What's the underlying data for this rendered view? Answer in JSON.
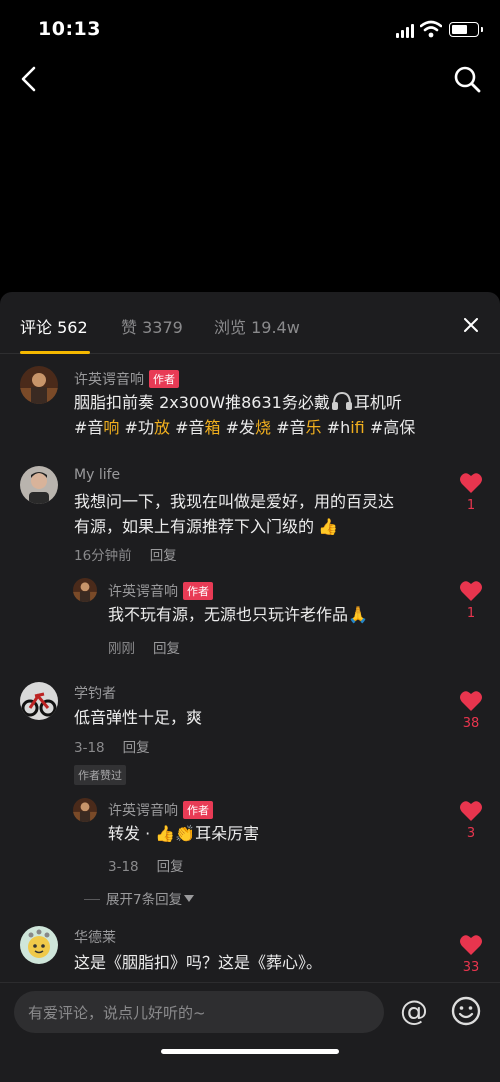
{
  "status": {
    "time": "10:13"
  },
  "tabs": [
    {
      "label": "评论 562"
    },
    {
      "label": "赞 3379"
    },
    {
      "label": "浏览 19.4w"
    }
  ],
  "colors": {
    "accent": "#f5b800",
    "like": "#e8354e",
    "author_badge": "#e83b55",
    "panel": "#1d1d1f"
  },
  "post": {
    "author": "许英谔音响",
    "badge": "作者",
    "text": "胭脂扣前奏 2x300W推8631务必戴",
    "text_after_icon": "耳机听",
    "tags": [
      {
        "prefix": "#音",
        "hl": "响"
      },
      {
        "prefix": "#功",
        "hl": "放"
      },
      {
        "prefix": "#音",
        "hl": "箱"
      },
      {
        "prefix": "#发",
        "hl": "烧"
      },
      {
        "prefix": "#音",
        "hl": "乐"
      },
      {
        "prefix": "#h",
        "hl": "ifi"
      },
      {
        "prefix": "#高保",
        "hl": ""
      }
    ]
  },
  "comments": [
    {
      "user": "My life",
      "line1": "我想问一下，我现在叫做是爱好，用的百灵达",
      "line2": "有源，如果上有源推荐下入门级的",
      "time": "16分钟前",
      "reply_label": "回复",
      "likes": "1",
      "reply": {
        "user": "许英谔音响",
        "badge": "作者",
        "text": "我不玩有源，无源也只玩许老作品",
        "time": "刚刚",
        "reply_label": "回复",
        "likes": "1"
      }
    },
    {
      "user": "学钓者",
      "text": "低音弹性十足，爽",
      "time": "3-18",
      "reply_label": "回复",
      "likes": "38",
      "author_liked": "作者赞过",
      "reply": {
        "user": "许英谔音响",
        "badge": "作者",
        "text": "转发 · ",
        "text_after": "耳朵厉害",
        "time": "3-18",
        "reply_label": "回复",
        "likes": "3"
      },
      "expand_label": "展开7条回复"
    },
    {
      "user": "华德莱",
      "text": "这是《胭脂扣》吗？这是《葬心》。",
      "likes": "33"
    }
  ],
  "input": {
    "placeholder": "有爱评论，说点儿好听的~"
  },
  "icons": {
    "back": "back-arrow-icon",
    "search": "search-icon",
    "close": "close-icon",
    "at": "at-icon",
    "emoji": "emoji-icon",
    "heart": "heart-icon"
  }
}
